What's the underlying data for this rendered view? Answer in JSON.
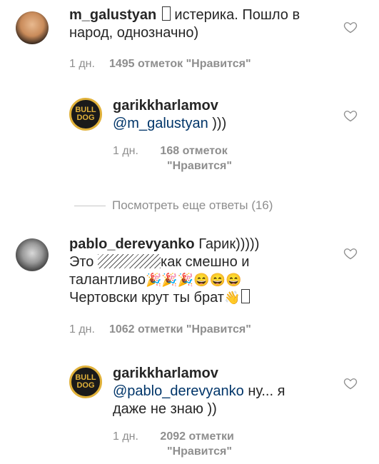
{
  "comments": [
    {
      "username": "m_galustyan",
      "text": "истерика. Пошло в народ, однозначно)",
      "time": "1 дн.",
      "likes": "1495 отметок \"Нравится\""
    },
    {
      "username": "garikkharlamov",
      "mention": "@m_galustyan",
      "text": ")))",
      "time": "1 дн.",
      "likes_line1": "168 отметок",
      "likes_line2": "\"Нравится\""
    },
    {
      "username": "pablo_derevyanko",
      "text_line1": "Гарик)))))",
      "text_line2a": "Это",
      "text_line2b": "как смешно и",
      "text_line3": "талантливо",
      "text_line4": "Чертовски крут ты брат",
      "time": "1 дн.",
      "likes": "1062 отметки \"Нравится\""
    },
    {
      "username": "garikkharlamov",
      "mention": "@pablo_derevyanko",
      "text_line1": "ну... я",
      "text_line2": "даже не знаю ))",
      "time": "1 дн.",
      "likes_line1": "2092 отметки",
      "likes_line2": "\"Нравится\""
    }
  ],
  "view_more": "Посмотреть еще ответы (16)",
  "avatar_logo": "BULL DOG",
  "icons": {
    "like": "heart-outline-icon",
    "party": "party-popper-emoji",
    "laugh": "grinning-emoji",
    "wave": "waving-hand-emoji"
  },
  "colors": {
    "text": "#262626",
    "meta": "#8e8e8e",
    "mention": "#003569"
  }
}
